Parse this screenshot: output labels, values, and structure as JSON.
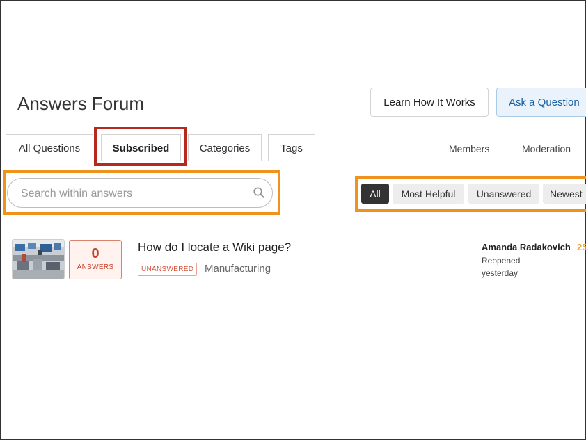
{
  "header": {
    "title": "Answers Forum",
    "learn_label": "Learn How It Works",
    "ask_label": "Ask a Question"
  },
  "tabs": [
    {
      "label": "All Questions"
    },
    {
      "label": "Subscribed",
      "active": true
    },
    {
      "label": "Categories"
    },
    {
      "label": "Tags"
    }
  ],
  "tab_links": {
    "members": "Members",
    "moderation": "Moderation"
  },
  "search": {
    "placeholder": "Search within answers",
    "value": ""
  },
  "filters": [
    {
      "label": "All",
      "active": true
    },
    {
      "label": "Most Helpful"
    },
    {
      "label": "Unanswered"
    },
    {
      "label": "Newest"
    }
  ],
  "questions": [
    {
      "answers_count": "0",
      "answers_label": "ANSWERS",
      "title": "How do I locate a Wiki page?",
      "status": "UNANSWERED",
      "category": "Manufacturing",
      "author": "Amanda Radakovich",
      "author_reputation": "25",
      "activity": "Reopened",
      "activity_time": "yesterday"
    }
  ],
  "colors": {
    "highlight_red": "#b52a1c",
    "highlight_orange": "#f0931d",
    "ask_blue": "#1a5fa0",
    "unanswered_red": "#c6432a",
    "reputation_gold": "#e8a33d"
  },
  "icons": {
    "search": "search-icon"
  }
}
